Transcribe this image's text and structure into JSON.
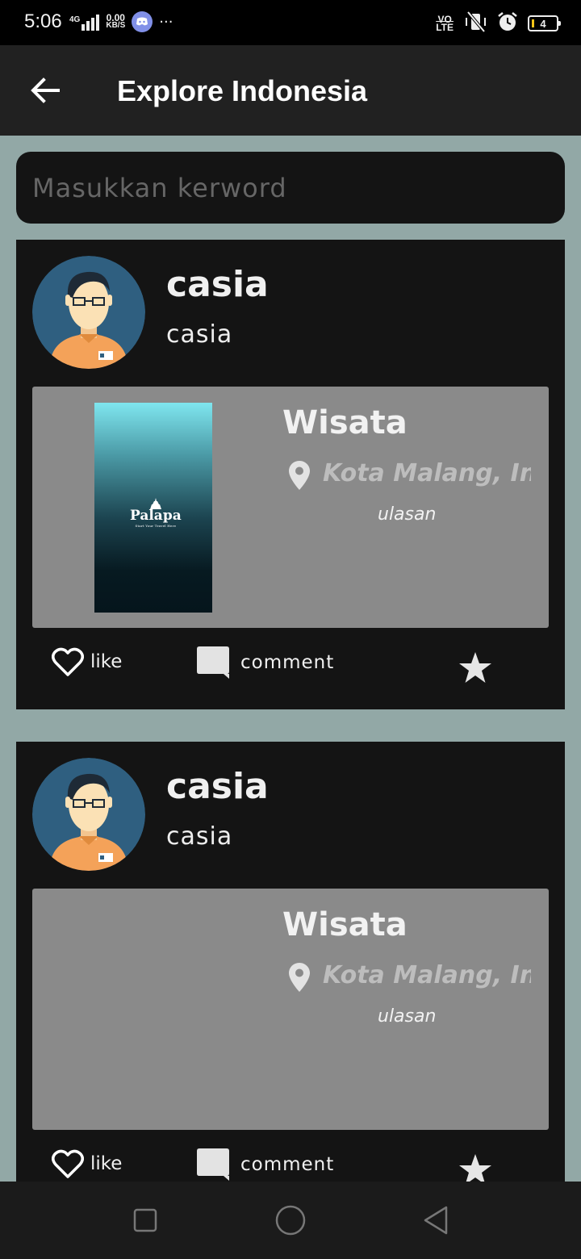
{
  "status_bar": {
    "time": "5:06",
    "network_type": "4G",
    "speed_value": "0.00",
    "speed_unit": "KB/S",
    "more": "···",
    "volte_top": "VO",
    "volte_bottom": "LTE",
    "battery_level": "4",
    "icons": [
      "signal-icon",
      "discord-icon",
      "vibrate-off-icon",
      "alarm-icon",
      "battery-icon"
    ]
  },
  "app_bar": {
    "title": "Explore Indonesia",
    "back_icon": "arrow-left-icon"
  },
  "search": {
    "placeholder": "Masukkan kerword",
    "value": ""
  },
  "posts": [
    {
      "name": "casia",
      "username": "casia",
      "place_title": "Wisata",
      "location": "Kota Malang, Indonesia",
      "review": "ulasan",
      "has_thumbnail": true,
      "thumbnail_text": "Palapa",
      "thumbnail_tagline": "Start Your Travel Here",
      "like_label": "like",
      "comment_label": "comment"
    },
    {
      "name": "casia",
      "username": "casia",
      "place_title": "Wisata",
      "location": "Kota Malang, Indonesia",
      "review": "ulasan",
      "has_thumbnail": false,
      "like_label": "like",
      "comment_label": "comment"
    }
  ],
  "colors": {
    "background": "#92a8a6",
    "card": "#141414",
    "app_bar": "#212121",
    "content_panel": "#8a8a8a",
    "avatar_bg": "#2f5f80",
    "shirt": "#f4a259"
  },
  "nav_bar": {
    "icons": [
      "recents-square-icon",
      "home-circle-icon",
      "back-triangle-icon"
    ]
  }
}
